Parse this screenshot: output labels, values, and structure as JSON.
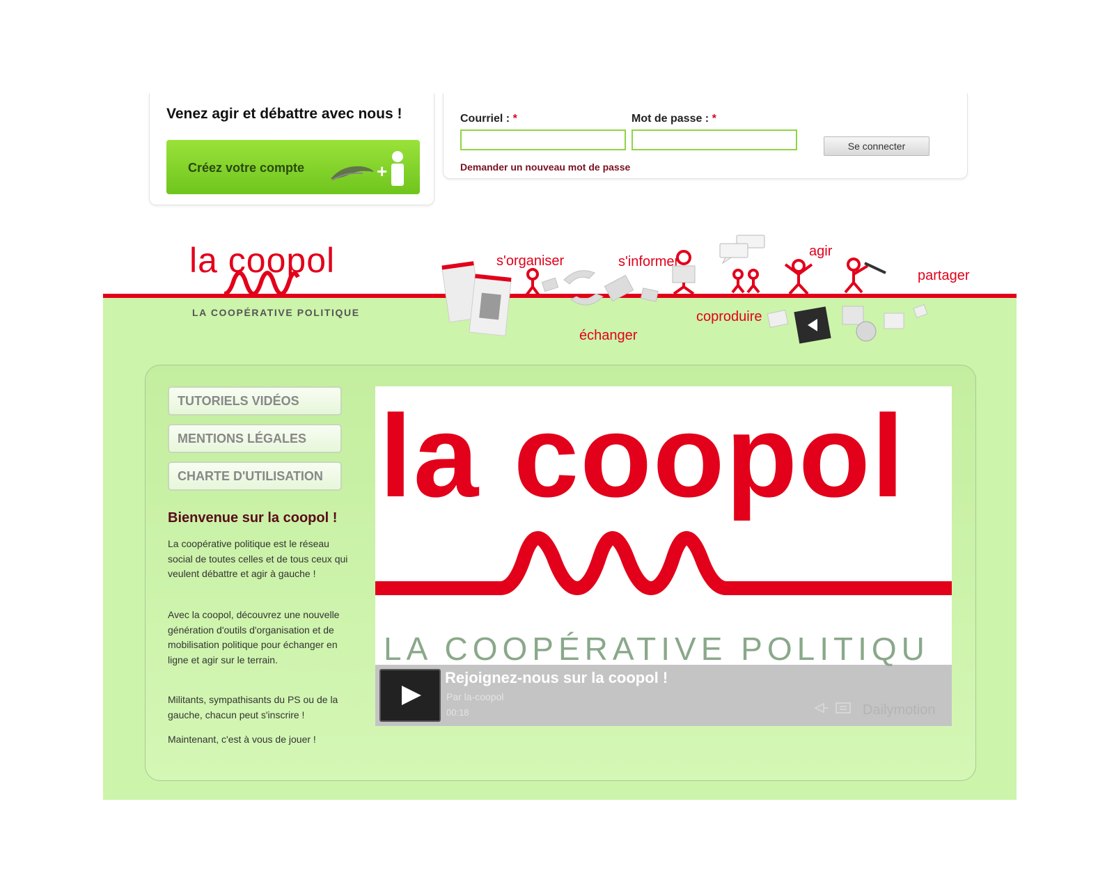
{
  "signup": {
    "title": "Venez agir et débattre avec nous !",
    "create_account_label": "Créez votre compte"
  },
  "login": {
    "email_label": "Courriel : ",
    "password_label": "Mot de passe : ",
    "required_mark": "*",
    "submit_label": "Se connecter",
    "forgot_password_link": "Demander un nouveau mot de passe"
  },
  "header": {
    "logo_text": "la coopol",
    "logo_subtitle": "LA COOPÉRATIVE POLITIQUE",
    "nav": {
      "organiser": "s'organiser",
      "informer": "s'informer",
      "agir": "agir",
      "partager": "partager",
      "echanger": "échanger",
      "coproduire": "coproduire"
    }
  },
  "sidebar": {
    "menu": [
      {
        "label": "TUTORIELS VIDÉOS"
      },
      {
        "label": "MENTIONS LÉGALES"
      },
      {
        "label": "CHARTE D'UTILISATION"
      }
    ],
    "welcome_title": "Bienvenue sur la coopol !",
    "paragraphs": [
      "La coopérative politique est le réseau social de toutes celles et de tous ceux qui veulent débattre et agir à gauche !",
      "Avec la coopol, découvrez une nouvelle génération d'outils d'organisation et de mobilisation politique pour échanger en ligne et agir sur le terrain.",
      "Militants, sympathisants du PS ou de la gauche, chacun peut s'inscrire !",
      "Maintenant, c'est à vous de jouer !"
    ]
  },
  "video": {
    "logo_text": "la coopol",
    "subtitle": "LA COOPÉRATIVE POLITIQU",
    "title": "Rejoignez-nous sur la coopol !",
    "author": "Par la-coopol",
    "duration": "00:18",
    "provider": "Dailymotion"
  },
  "colors": {
    "brand_red": "#e2001a",
    "brand_green": "#7ed321",
    "background_green": "#ccf4aa",
    "welcome_title": "#5a0a1a"
  },
  "icons": [
    "user-plus-icon",
    "play-icon",
    "like-icon",
    "share-icon",
    "fullscreen-icon"
  ]
}
